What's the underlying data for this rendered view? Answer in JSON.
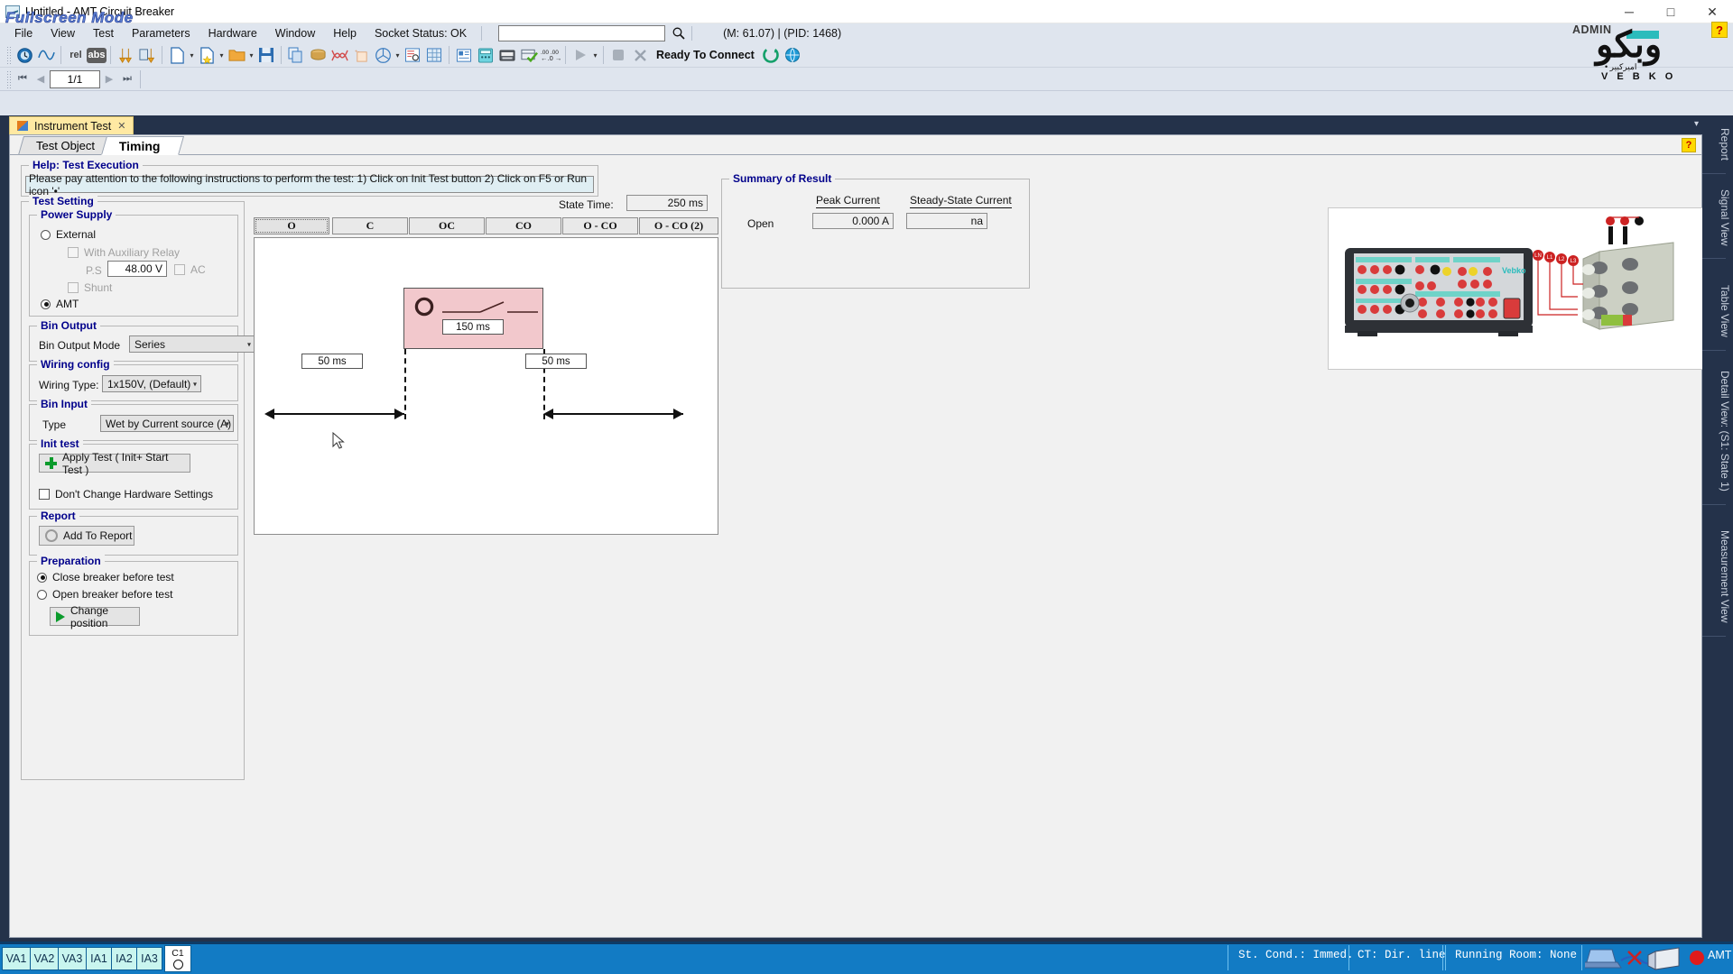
{
  "window": {
    "title": "Untitled - AMT Circuit Breaker",
    "app_icon": "waveform-icon",
    "minimize": "─",
    "maximize": "□",
    "close": "✕",
    "watermark": "Fullscreen Mode"
  },
  "menu": {
    "items": [
      "File",
      "View",
      "Test",
      "Parameters",
      "Hardware",
      "Window",
      "Help"
    ],
    "socket_status": "Socket Status: OK",
    "search_value": "",
    "search_placeholder": "",
    "search_icon": "search-icon",
    "mem_pid": "(M: 61.07) | (PID: 1468)"
  },
  "brand": {
    "admin": "ADMIN",
    "logo_main": "وبکو",
    "logo_sub1": "امیرکبیر •",
    "logo_sub2": "V E B K O",
    "help": "?"
  },
  "toolbar": {
    "row1": [
      {
        "icon": "clock-globe-icon",
        "label": ""
      },
      {
        "icon": "sine-wave-icon",
        "label": ""
      },
      {
        "icon": "relative-icon",
        "label": "rel"
      },
      {
        "icon": "absolute-icon",
        "label": "abs"
      },
      {
        "icon": "down-arrows-icon",
        "label": ""
      },
      {
        "icon": "down-arrows-bars-icon",
        "label": ""
      },
      {
        "icon": "new-file-icon",
        "label": ""
      },
      {
        "icon": "new-template-icon",
        "label": ""
      },
      {
        "icon": "open-folder-icon",
        "label": ""
      },
      {
        "icon": "save-icon",
        "label": ""
      },
      {
        "icon": "copy-icon",
        "label": ""
      },
      {
        "icon": "coil-icon",
        "label": ""
      },
      {
        "icon": "crossed-waves-icon",
        "label": ""
      },
      {
        "icon": "calculator-small-icon",
        "label": ""
      },
      {
        "icon": "phasor-icon",
        "label": ""
      },
      {
        "icon": "report-search-icon",
        "label": ""
      },
      {
        "icon": "table-grid-icon",
        "label": ""
      },
      {
        "icon": "detail-view-icon",
        "label": ""
      },
      {
        "icon": "calculator-icon",
        "label": ""
      },
      {
        "icon": "keyboard-icon",
        "label": ""
      },
      {
        "icon": "check-card-icon",
        "label": ""
      },
      {
        "icon": "decimals-icon",
        "label": ""
      },
      {
        "icon": "run-icon",
        "label": ""
      },
      {
        "icon": "stop-icon",
        "label": ""
      },
      {
        "icon": "abort-icon",
        "label": ""
      }
    ],
    "ready_label": "Ready To Connect",
    "refresh_icon": "refresh-connect-icon",
    "net_icon": "network-icon",
    "page_indicator": "1/1",
    "nav_first": "first-page-icon",
    "nav_prev": "prev-page-icon",
    "nav_next": "next-page-icon",
    "nav_last": "last-page-icon"
  },
  "mdi": {
    "tab_label": "Instrument Test",
    "tab_icon": "window-icon",
    "close": "✕",
    "dropdown": "▾"
  },
  "form_tabs": [
    {
      "label": "Test Object",
      "active": false
    },
    {
      "label": "Timing",
      "active": true
    }
  ],
  "form_help_badge": "?",
  "help_group": {
    "title": "Help: Test Execution",
    "text": "Please pay attention to the following instructions to perform the test: 1) Click on Init Test button  2) Click on F5 or Run icon '•'"
  },
  "test_setting": {
    "title": "Test Setting",
    "power_supply": {
      "title": "Power Supply",
      "external": {
        "label": "External",
        "selected": false
      },
      "with_auxiliary_relay": {
        "label": "With Auxiliary Relay",
        "checked": false,
        "disabled": true
      },
      "ps_label": "P.S",
      "ps_value": "48.00 V",
      "ac": {
        "label": "AC",
        "checked": false,
        "disabled": true
      },
      "shunt": {
        "label": "Shunt",
        "checked": false,
        "disabled": true
      },
      "amt": {
        "label": "AMT",
        "selected": true
      }
    },
    "bin_output": {
      "title": "Bin Output",
      "label": "Bin Output Mode",
      "value": "Series"
    },
    "wiring_config": {
      "title": "Wiring config",
      "label": "Wiring Type:",
      "value": "1x150V, (Default)"
    },
    "bin_input": {
      "title": "Bin Input",
      "label": "Type",
      "value": "Wet by Current source (A)"
    },
    "init_test": {
      "title": "Init test",
      "button": "Apply Test ( Init+ Start Test )",
      "button_icon": "plus-icon",
      "dont_change": {
        "label": "Don't Change Hardware Settings",
        "checked": false
      }
    },
    "report": {
      "title": "Report",
      "button": "Add To Report",
      "button_icon": "gear-icon"
    },
    "preparation": {
      "title": "Preparation",
      "close_before": {
        "label": "Close breaker before test",
        "selected": true
      },
      "open_before": {
        "label": "Open breaker before test",
        "selected": false
      },
      "change_position": {
        "label": "Change position",
        "icon": "play-icon"
      }
    }
  },
  "state_time": {
    "label": "State Time:",
    "value": "250 ms"
  },
  "state_tabs": [
    {
      "label": "O",
      "active": true
    },
    {
      "label": "C",
      "active": false
    },
    {
      "label": "OC",
      "active": false
    },
    {
      "label": "CO",
      "active": false
    },
    {
      "label": "O - CO",
      "active": false
    },
    {
      "label": "O - CO (2)",
      "active": false
    }
  ],
  "diagram": {
    "state_icon": "open-breaker-icon",
    "switch_icon": "switch-contact-icon",
    "state_duration": "150 ms",
    "pre_duration": "50 ms",
    "post_duration": "50 ms",
    "fill_color": "#f2c8cc",
    "cursor": "mouse-pointer"
  },
  "summary": {
    "title": "Summary of Result",
    "columns": [
      "Peak Current",
      "Steady-State Current"
    ],
    "rows": [
      {
        "label": "Open",
        "peak_current": "0.000 A",
        "steady_state_current": "na"
      }
    ]
  },
  "device_picture": {
    "caption": "amt-test-set-wiring-diagram",
    "brand": "Vebko"
  },
  "side_tabs": [
    {
      "label": "Report"
    },
    {
      "label": "Signal View"
    },
    {
      "label": "Table View"
    },
    {
      "label": "Detail View: (S1: State 1)"
    },
    {
      "label": "Measurement View"
    }
  ],
  "statusbar": {
    "channels": [
      "VA1",
      "VA2",
      "VA3",
      "IA1",
      "IA2",
      "IA3"
    ],
    "c1_label": "C1",
    "c1_state_icon": "open-circle-icon",
    "st_cond": "St. Cond.: Immed.",
    "ct": "CT: Dir. line",
    "running_room": "Running Room: None",
    "link_icon": "pc-device-link-icon",
    "device_state_color": "#e01b1b",
    "device_label": "AMT",
    "device_caret": "▾"
  }
}
